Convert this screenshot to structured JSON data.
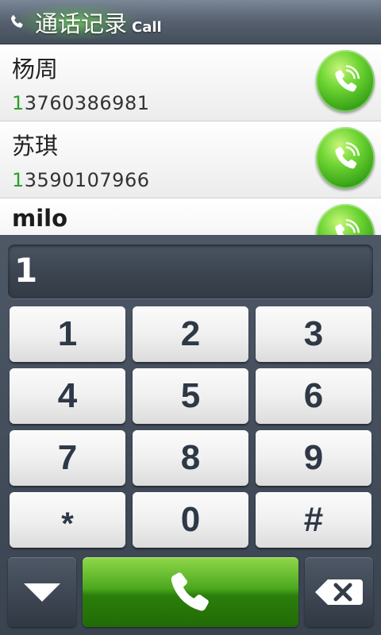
{
  "header": {
    "title": "通话记录",
    "subtitle": "Call",
    "icon": "phone-icon",
    "accent": "#7ce05a"
  },
  "contacts": [
    {
      "name": "杨周",
      "number_prefix": "1",
      "number_rest": "3760386981"
    },
    {
      "name": "苏琪",
      "number_prefix": "1",
      "number_rest": "3590107966"
    },
    {
      "name": "milo",
      "number_prefix": "",
      "number_rest": ""
    }
  ],
  "dialer": {
    "input_value": "1",
    "keys": [
      "1",
      "2",
      "3",
      "4",
      "5",
      "6",
      "7",
      "8",
      "9",
      "*",
      "0",
      "#"
    ]
  },
  "actions": {
    "collapse_icon": "chevron-down-icon",
    "dial_icon": "phone-icon",
    "delete_icon": "backspace-icon"
  },
  "colors": {
    "match_highlight": "#2aa12a",
    "call_green": "#4ca81e",
    "key_text": "#2e3846"
  }
}
